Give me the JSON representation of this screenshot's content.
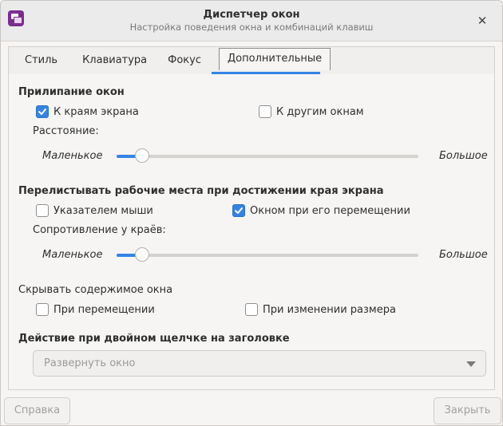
{
  "window": {
    "title": "Диспетчер окон",
    "subtitle": "Настройка поведения окна и комбинаций клавиш",
    "close_icon": "close-icon",
    "app_icon": "window-manager-icon"
  },
  "tabs": [
    {
      "label": "Стиль",
      "active": false
    },
    {
      "label": "Клавиатура",
      "active": false
    },
    {
      "label": "Фокус",
      "active": false
    },
    {
      "label": "Дополнительные",
      "active": true
    }
  ],
  "snapping": {
    "heading": "Прилипание окон",
    "to_screen_edges": {
      "label": "К краям экрана",
      "checked": true
    },
    "to_other_windows": {
      "label": "К другим окнам",
      "checked": false
    },
    "distance_label": "Расстояние:",
    "slider": {
      "min_label": "Маленькое",
      "max_label": "Большое",
      "value_fraction": 0.04
    }
  },
  "workspace_wrap": {
    "heading": "Перелистывать рабочие места при достижении края экрана",
    "with_pointer": {
      "label": "Указателем мыши",
      "checked": false
    },
    "with_window": {
      "label": "Окном при его перемещении",
      "checked": true
    },
    "resistance_label": "Сопротивление у краёв:",
    "slider": {
      "min_label": "Маленькое",
      "max_label": "Большое",
      "value_fraction": 0.04
    }
  },
  "hide_content": {
    "heading": "Скрывать содержимое окна",
    "on_move": {
      "label": "При перемещении",
      "checked": false
    },
    "on_resize": {
      "label": "При изменении размера",
      "checked": false
    }
  },
  "double_click": {
    "heading": "Действие при двойном щелчке на заголовке",
    "selected": "Развернуть окно"
  },
  "footer": {
    "help_label": "Справка",
    "close_label": "Закрыть"
  },
  "colors": {
    "accent": "#3584e4",
    "app_icon": "#7b2d8e"
  }
}
